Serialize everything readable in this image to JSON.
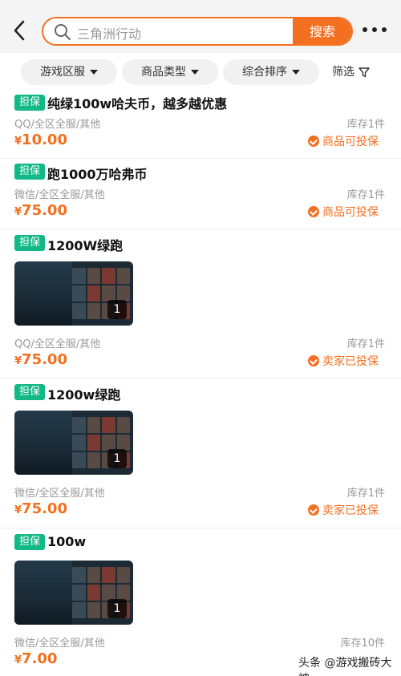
{
  "header": {
    "search_placeholder": "三角洲行动",
    "search_button": "搜索"
  },
  "filters": {
    "region": "游戏区服",
    "product_type": "商品类型",
    "sort": "综合排序",
    "screen": "筛选"
  },
  "items": [
    {
      "badge": "担保",
      "title": "纯绿100w哈夫币，越多越优惠",
      "meta": "QQ/全区全服/其他",
      "stock": "库存1件",
      "price_symbol": "¥",
      "price": "10.00",
      "guarantee": "商品可投保",
      "image_count": null
    },
    {
      "badge": "担保",
      "title": "跑1000万哈弗币",
      "meta": "微信/全区全服/其他",
      "stock": "库存1件",
      "price_symbol": "¥",
      "price": "75.00",
      "guarantee": "商品可投保",
      "image_count": null
    },
    {
      "badge": "担保",
      "title": "1200W绿跑",
      "meta": "QQ/全区全服/其他",
      "stock": "库存1件",
      "price_symbol": "¥",
      "price": "75.00",
      "guarantee": "卖家已投保",
      "image_count": "1"
    },
    {
      "badge": "担保",
      "title": "1200w绿跑",
      "meta": "微信/全区全服/其他",
      "stock": "库存1件",
      "price_symbol": "¥",
      "price": "75.00",
      "guarantee": "卖家已投保",
      "image_count": "1"
    },
    {
      "badge": "担保",
      "title": "100w",
      "meta": "微信/全区全服/其他",
      "stock": "库存10件",
      "price_symbol": "¥",
      "price": "7.00",
      "guarantee": "",
      "image_count": "1"
    }
  ],
  "watermark": "头条 @游戏搬砖大神",
  "colors": {
    "accent": "#f37021",
    "badge": "#12b886"
  }
}
